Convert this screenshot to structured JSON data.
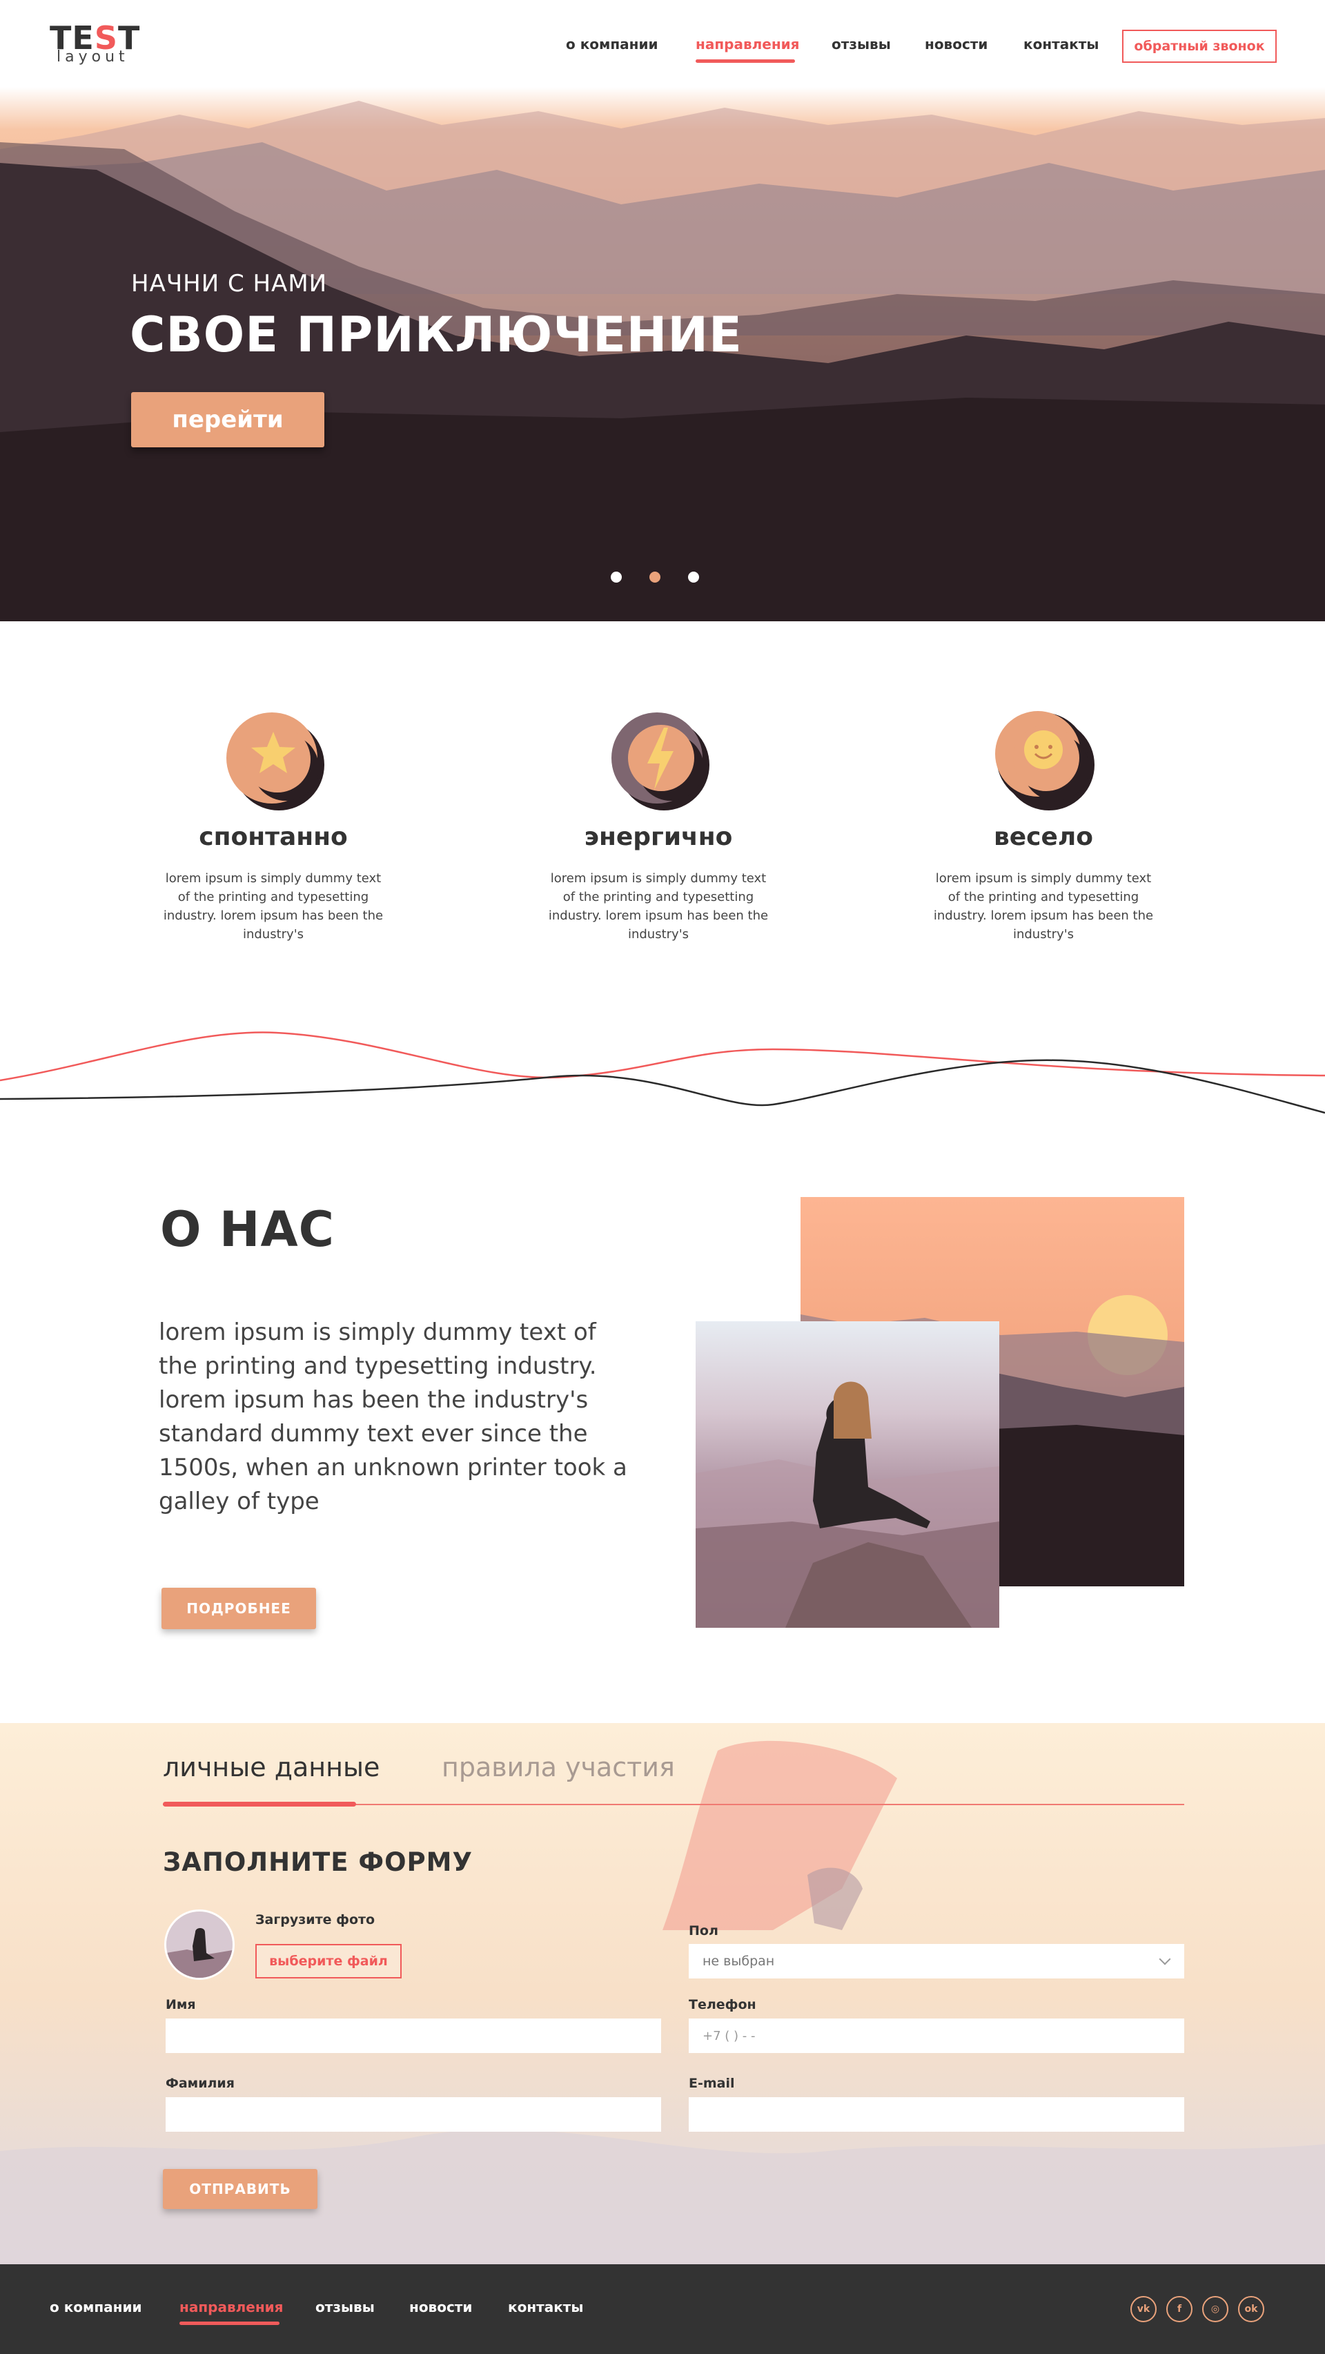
{
  "brand": {
    "logo_main_1": "TE",
    "logo_main_s": "S",
    "logo_main_2": "T",
    "logo_sub": "layout",
    "accent": "#f15a5a",
    "button": "#e9a27b"
  },
  "nav": {
    "items": [
      "о компании",
      "направления",
      "отзывы",
      "новости",
      "контакты"
    ],
    "active": "направления",
    "callback": "обратный звонок"
  },
  "hero": {
    "kicker": "НАЧНИ С НАМИ",
    "title": "СВОЕ ПРИКЛЮЧЕНИЕ",
    "button": "перейти",
    "slides": 3,
    "active_slide": 2
  },
  "features": [
    {
      "icon": "star-icon",
      "title": "спонтанно",
      "text": "lorem ipsum is simply dummy text of the printing and typesetting industry. lorem ipsum has been the industry's"
    },
    {
      "icon": "lightning-icon",
      "title": "энергично",
      "text": "lorem ipsum is simply dummy text of the printing and typesetting industry. lorem ipsum has been the industry's"
    },
    {
      "icon": "smile-icon",
      "title": "весело",
      "text": "lorem ipsum is simply dummy text of the printing and typesetting industry. lorem ipsum has been the industry's"
    }
  ],
  "about": {
    "title": "О НАС",
    "text": "lorem ipsum is simply dummy text of the printing and typesetting industry. lorem ipsum has been the industry's standard dummy text ever since the 1500s, when an unknown printer took a galley of type",
    "button": "ПОДРОБНЕЕ"
  },
  "form": {
    "tabs": [
      "личные данные",
      "правила участия"
    ],
    "active_tab": "личные данные",
    "title": "ЗАПОЛНИТЕ ФОРМУ",
    "upload_label": "Загрузите фото",
    "upload_button": "выберите файл",
    "gender_label": "Пол",
    "gender_value": "не выбран",
    "name_label": "Имя",
    "phone_label": "Телефон",
    "phone_placeholder": "+7 (   )   -   -",
    "surname_label": "Фамилия",
    "email_label": "E-mail",
    "submit": "ОТПРАВИТЬ"
  },
  "footer": {
    "items": [
      "о компании",
      "направления",
      "отзывы",
      "новости",
      "контакты"
    ],
    "active": "направления",
    "social": [
      {
        "icon": "vk-icon",
        "glyph": "vk"
      },
      {
        "icon": "facebook-icon",
        "glyph": "f"
      },
      {
        "icon": "instagram-icon",
        "glyph": "◎"
      },
      {
        "icon": "odnoklassniki-icon",
        "glyph": "ok"
      }
    ]
  }
}
